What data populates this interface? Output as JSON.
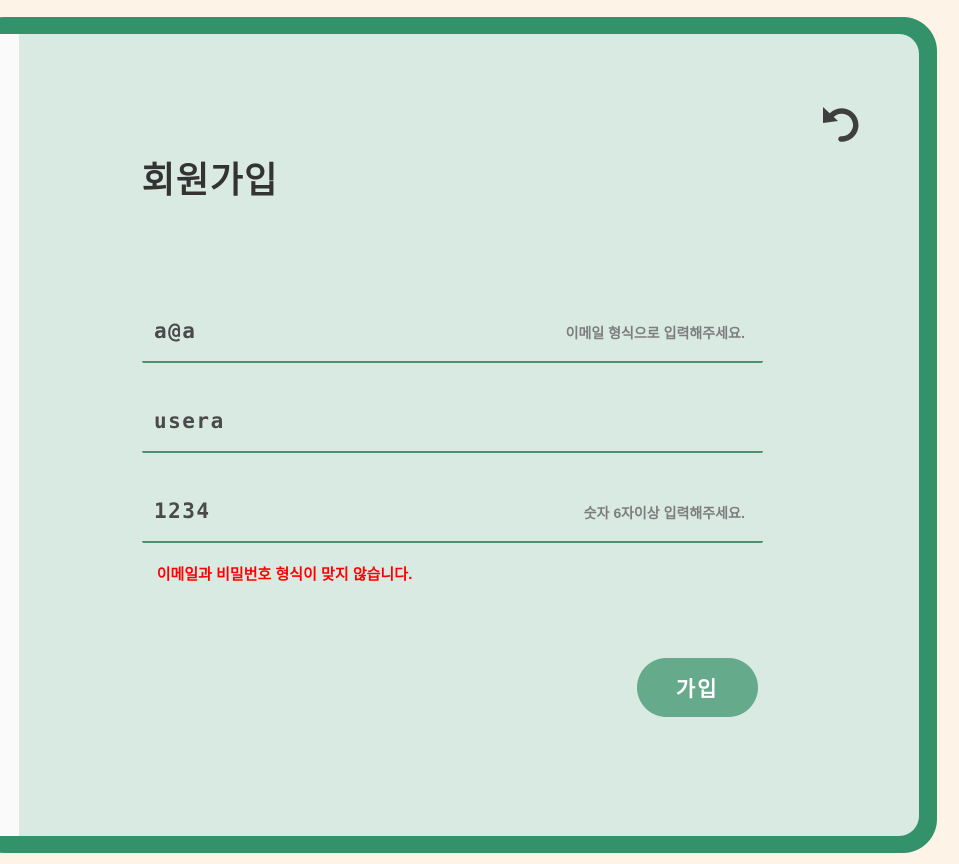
{
  "colors": {
    "page_background": "#fdf3e6",
    "frame_border": "#34926b",
    "panel_background": "#d9eae3",
    "field_underline": "#4e8e72",
    "button_background": "#66aa8c",
    "error_text": "#ff0000"
  },
  "header": {
    "back_icon": "undo-arrow-icon",
    "title": "회원가입"
  },
  "form": {
    "email": {
      "value": "a@a",
      "hint": "이메일 형식으로 입력해주세요."
    },
    "username": {
      "value": "usera"
    },
    "password": {
      "value": "1234",
      "hint": "숫자 6자이상 입력해주세요."
    },
    "error_message": "이메일과 비밀번호 형식이 맞지 않습니다.",
    "submit_label": "가입"
  }
}
